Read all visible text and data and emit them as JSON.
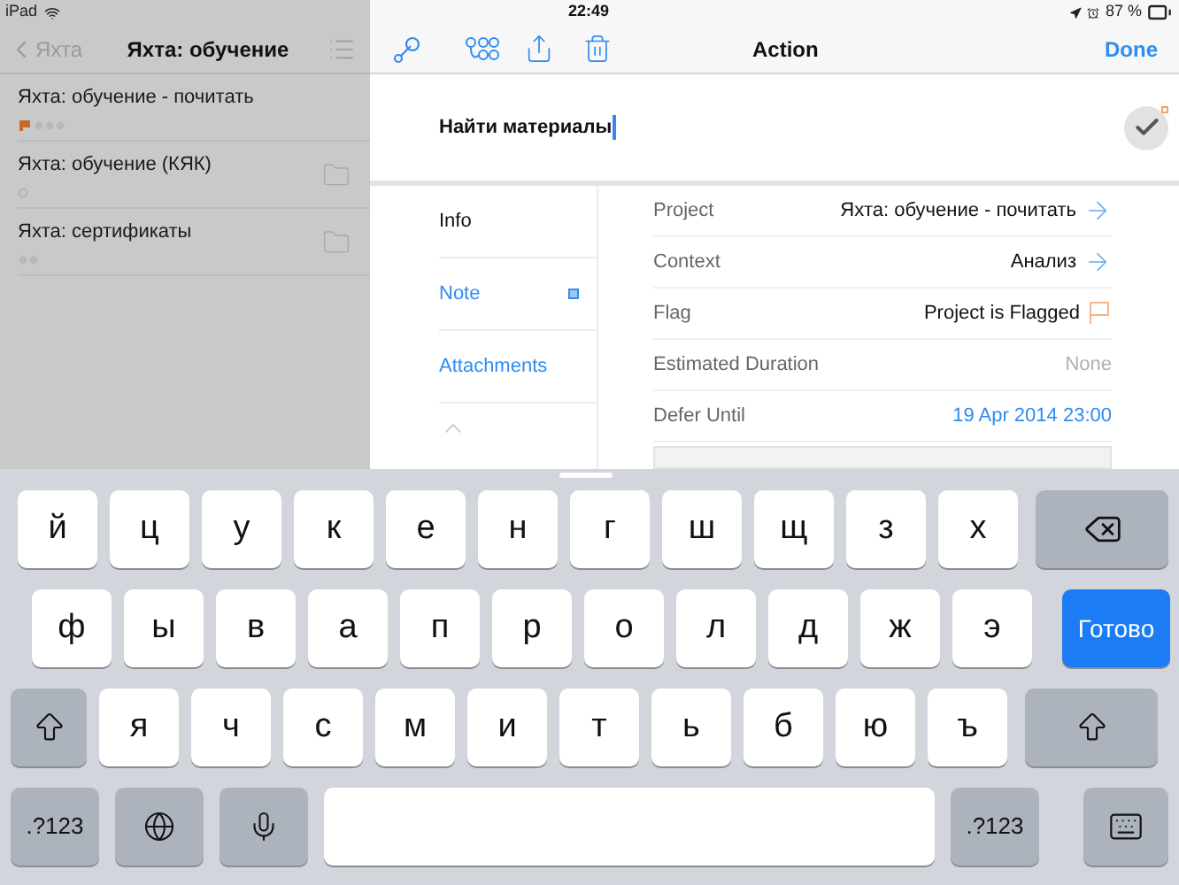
{
  "status_bar": {
    "device": "iPad",
    "time": "22:49",
    "battery": "87 %"
  },
  "sidebar": {
    "back": "Яхта",
    "title": "Яхта: обучение",
    "items": [
      {
        "title": "Яхта: обучение - почитать",
        "kind": "flag_dots",
        "folder": false
      },
      {
        "title": "Яхта: обучение (КЯК)",
        "kind": "ring",
        "folder": true
      },
      {
        "title": "Яхта: сертификаты",
        "kind": "dots",
        "folder": true
      }
    ]
  },
  "detail": {
    "title": "Action",
    "done": "Done",
    "action_name": "Найти материалы",
    "tabs": [
      {
        "label": "Info",
        "selected": true,
        "marked": false
      },
      {
        "label": "Note",
        "selected": false,
        "marked": true
      },
      {
        "label": "Attachments",
        "selected": false,
        "marked": false
      }
    ],
    "fields": [
      {
        "label": "Project",
        "value": "Яхта: обучение - почитать",
        "kind": "link"
      },
      {
        "label": "Context",
        "value": "Анализ",
        "kind": "link"
      },
      {
        "label": "Flag",
        "value": "Project is Flagged",
        "kind": "flag"
      },
      {
        "label": "Estimated Duration",
        "value": "None",
        "kind": "plain"
      },
      {
        "label": "Defer Until",
        "value": "19 Apr 2014  23:00",
        "kind": "date"
      }
    ]
  },
  "keyboard": {
    "rows": [
      {
        "keys": [
          {
            "kind": "letter",
            "label": "й"
          },
          {
            "kind": "letter",
            "label": "ц"
          },
          {
            "kind": "letter",
            "label": "у"
          },
          {
            "kind": "letter",
            "label": "к"
          },
          {
            "kind": "letter",
            "label": "е"
          },
          {
            "kind": "letter",
            "label": "н"
          },
          {
            "kind": "letter",
            "label": "г"
          },
          {
            "kind": "letter",
            "label": "ш"
          },
          {
            "kind": "letter",
            "label": "щ"
          },
          {
            "kind": "letter",
            "label": "з"
          },
          {
            "kind": "letter",
            "label": "х"
          },
          {
            "kind": "delete"
          }
        ]
      },
      {
        "keys": [
          {
            "kind": "letter",
            "label": "ф"
          },
          {
            "kind": "letter",
            "label": "ы"
          },
          {
            "kind": "letter",
            "label": "в"
          },
          {
            "kind": "letter",
            "label": "а"
          },
          {
            "kind": "letter",
            "label": "п"
          },
          {
            "kind": "letter",
            "label": "р"
          },
          {
            "kind": "letter",
            "label": "о"
          },
          {
            "kind": "letter",
            "label": "л"
          },
          {
            "kind": "letter",
            "label": "д"
          },
          {
            "kind": "letter",
            "label": "ж"
          },
          {
            "kind": "letter",
            "label": "э"
          },
          {
            "kind": "done",
            "label": "Готово"
          }
        ]
      },
      {
        "keys": [
          {
            "kind": "shift"
          },
          {
            "kind": "letter",
            "label": "я"
          },
          {
            "kind": "letter",
            "label": "ч"
          },
          {
            "kind": "letter",
            "label": "с"
          },
          {
            "kind": "letter",
            "label": "м"
          },
          {
            "kind": "letter",
            "label": "и"
          },
          {
            "kind": "letter",
            "label": "т"
          },
          {
            "kind": "letter",
            "label": "ь"
          },
          {
            "kind": "letter",
            "label": "б"
          },
          {
            "kind": "letter",
            "label": "ю"
          },
          {
            "kind": "letter",
            "label": "ъ"
          },
          {
            "kind": "shift"
          }
        ]
      },
      {
        "keys": [
          {
            "kind": "numbers",
            "label": ".?123"
          },
          {
            "kind": "globe"
          },
          {
            "kind": "mic"
          },
          {
            "kind": "space"
          },
          {
            "kind": "numbers",
            "label": ".?123"
          },
          {
            "kind": "hide"
          }
        ]
      }
    ]
  }
}
